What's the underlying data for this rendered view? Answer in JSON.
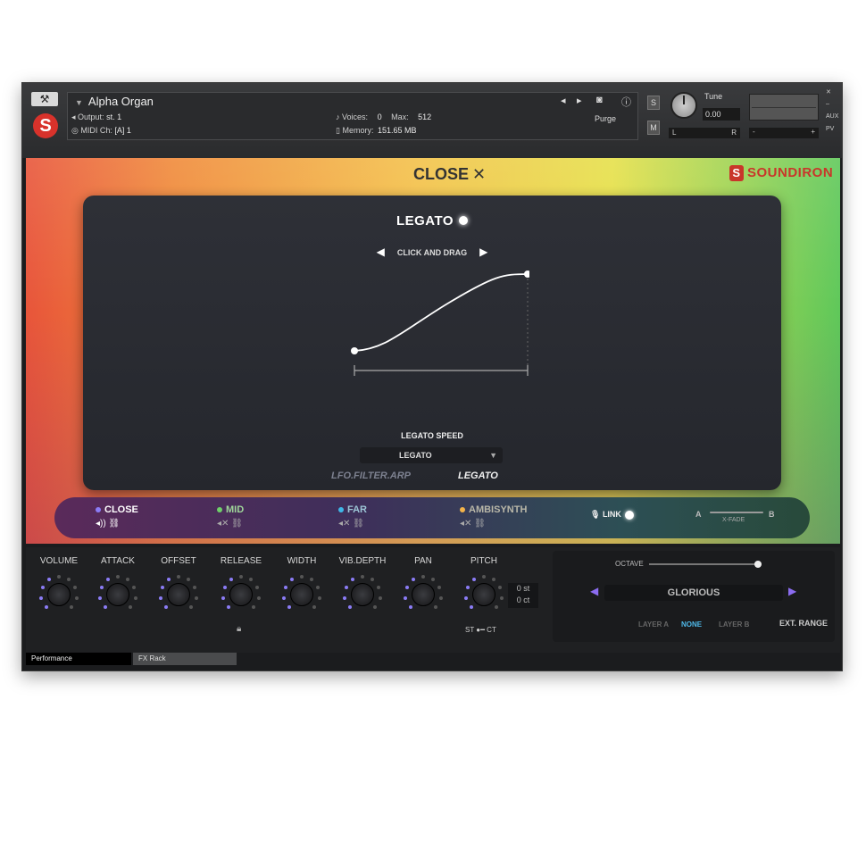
{
  "header": {
    "instrument_name": "Alpha Organ",
    "output_label": "Output:",
    "output_value": "st. 1",
    "midi_label": "MIDI Ch:",
    "midi_value": "[A] 1",
    "voices_label": "Voices:",
    "voices_value": "0",
    "max_label": "Max:",
    "max_value": "512",
    "memory_label": "Memory:",
    "memory_value": "151.65 MB",
    "purge_label": "Purge",
    "solo": "S",
    "mute": "M",
    "tune_label": "Tune",
    "tune_value": "0.00",
    "left": "L",
    "right": "R",
    "aux": "AUX",
    "pv": "PV",
    "minus": "-",
    "plus": "+"
  },
  "art": {
    "close_label": "CLOSE",
    "brand": "SOUNDIRON"
  },
  "panel": {
    "title": "LEGATO",
    "click_drag": "CLICK AND DRAG",
    "legato_speed_label": "LEGATO SPEED",
    "legato_speed_value": "LEGATO",
    "tab_lfo": "LFO.FILTER.ARP",
    "tab_legato": "LEGATO"
  },
  "mics": {
    "items": [
      {
        "label": "CLOSE",
        "color": "#8b7cf6"
      },
      {
        "label": "MID",
        "color": "#6fd06a"
      },
      {
        "label": "FAR",
        "color": "#3fb7e8"
      },
      {
        "label": "AMBISYNTH",
        "color": "#f3b34a"
      }
    ],
    "link": "LINK",
    "xfade_a": "A",
    "xfade_b": "B",
    "xfade_label": "X-FADE"
  },
  "controls": {
    "knobs": [
      "VOLUME",
      "ATTACK",
      "OFFSET",
      "RELEASE",
      "WIDTH",
      "VIB.DEPTH",
      "PAN",
      "PITCH"
    ],
    "pitch_st": "0 st",
    "pitch_ct": "0 ct",
    "st": "ST",
    "ct": "CT",
    "octave_label": "OCTAVE",
    "preset": "GLORIOUS",
    "layer_a": "LAYER A",
    "none": "NONE",
    "layer_b": "LAYER B",
    "ext_range": "EXT. RANGE"
  },
  "footer": {
    "tab_performance": "Performance",
    "tab_fxrack": "FX Rack"
  }
}
